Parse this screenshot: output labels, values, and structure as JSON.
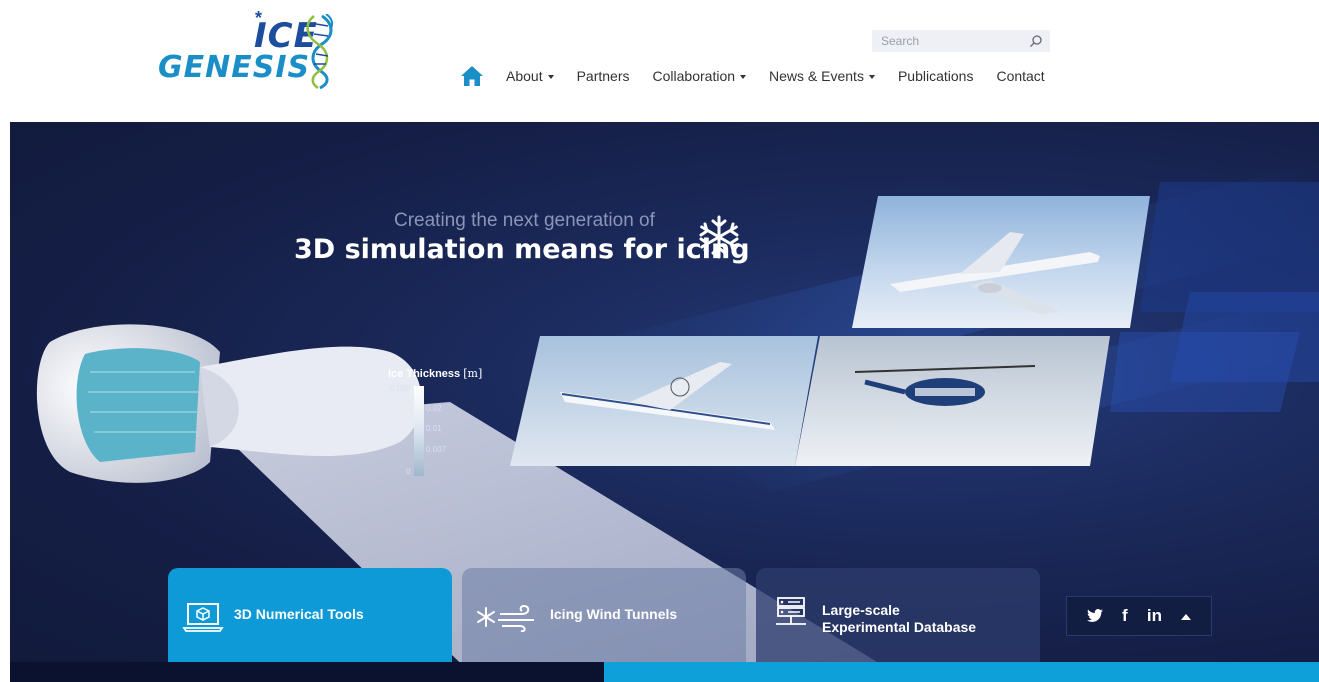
{
  "brand": {
    "logo_line1": "ICE",
    "logo_line2": "GENESIS",
    "logo_star": "*",
    "colors": {
      "dark_blue": "#1d4e9e",
      "light_blue": "#1a8ec7"
    }
  },
  "search": {
    "placeholder": "Search",
    "icon": "search-icon"
  },
  "nav": {
    "home_icon": "home-icon",
    "items": [
      {
        "label": "About",
        "dropdown": true
      },
      {
        "label": "Partners",
        "dropdown": false
      },
      {
        "label": "Collaboration",
        "dropdown": true
      },
      {
        "label": "News & Events",
        "dropdown": true
      },
      {
        "label": "Publications",
        "dropdown": false
      },
      {
        "label": "Contact",
        "dropdown": false
      }
    ]
  },
  "hero": {
    "tagline_small": "Creating the next generation of",
    "tagline_big": "3D simulation means for icing",
    "legend": {
      "title": "Ice Thickness",
      "unit": "[m]",
      "labels": [
        "0.029",
        "0.02",
        "0.01",
        "0.007",
        "0"
      ]
    },
    "colors": {
      "accent": "#0d9ad7",
      "background": "#151f47"
    }
  },
  "tabs": [
    {
      "label": "3D Numerical Tools",
      "icon": "laptop-cube-icon",
      "active": true
    },
    {
      "label": "Icing Wind Tunnels",
      "icon": "snow-wind-icon",
      "active": false
    },
    {
      "label_line1": "Large-scale",
      "label_line2": "Experimental Database",
      "icon": "server-icon",
      "active": false
    }
  ],
  "social": {
    "twitter": "twitter-icon",
    "facebook": "f",
    "linkedin": "in",
    "up": "up-arrow-icon"
  }
}
